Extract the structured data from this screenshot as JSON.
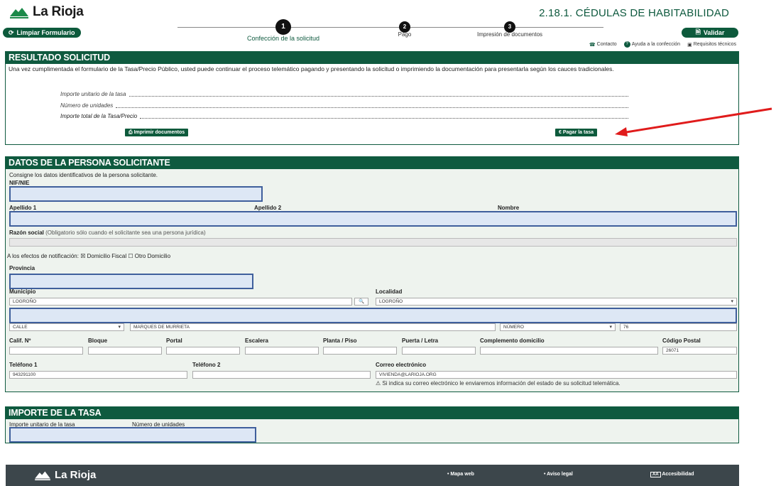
{
  "header": {
    "logo_text": "La Rioja",
    "procedure_title": "2.18.1. CÉDULAS DE HABITABILIDAD",
    "clear_button": "Limpiar Formulario",
    "validate_button": "Validar"
  },
  "steps": [
    {
      "number": "1",
      "label": "Confección de la solicitud"
    },
    {
      "number": "2",
      "label": "Pago"
    },
    {
      "number": "3",
      "label": "Impresión de documentos"
    }
  ],
  "help_links": {
    "contact": "Contacto",
    "help": "Ayuda a la confección",
    "requirements": "Requisitos técnicos"
  },
  "result": {
    "title": "RESULTADO SOLICITUD",
    "text": "Una vez cumplimentada el formulario de la Tasa/Precio Público, usted puede continuar el proceso telemático pagando y presentando la solicitud o imprimiendo la documentación para presentarla según los cauces tradicionales.",
    "unit_price_label": "Importe unitario de la tasa",
    "units_label": "Número de unidades",
    "total_label": "Importe total de la Tasa/Precio",
    "print_button": "Imprimir documentos",
    "pay_button": "€ Pagar la tasa"
  },
  "applicant": {
    "title": "DATOS DE LA PERSONA SOLICITANTE",
    "intro": "Consigne los datos identificativos de la persona solicitante.",
    "nif_label": "NIF/NIE",
    "surname1_label": "Apellido 1",
    "surname2_label": "Apellido 2",
    "name_label": "Nombre",
    "business_label": "Razón social",
    "business_note": "(Obligatorio sólo cuando el solicitante sea una persona jurídica)",
    "notification_label": "A los efectos de notificación:",
    "notif_option1": "Domicilio Fiscal",
    "notif_option2": "Otro Domicilio",
    "province_label": "Provincia",
    "municipality_label": "Municipio",
    "municipality_value": "LOGROÑO",
    "locality_label": "Localidad",
    "locality_value": "LOGROÑO",
    "street_type": "CALLE",
    "street_name": "MARQUES DE MURRIETA",
    "number_type": "NÚMERO",
    "number_value": "76",
    "calif_label": "Calif. Nº",
    "block_label": "Bloque",
    "portal_label": "Portal",
    "stair_label": "Escalera",
    "floor_label": "Planta / Piso",
    "door_label": "Puerta / Letra",
    "complement_label": "Complemento domicilio",
    "postal_label": "Código Postal",
    "postal_value": "26071",
    "phone1_label": "Teléfono 1",
    "phone1_value": "943291100",
    "phone2_label": "Teléfono 2",
    "email_label": "Correo electrónico",
    "email_value": "VIVIENDA@LARIOJA.ORG",
    "email_note": "Si indica su correo electrónico le enviaremos información del estado de su solicitud telemática."
  },
  "fee": {
    "title": "IMPORTE DE LA TASA",
    "unit_price_label": "Importe unitario de la tasa",
    "units_label": "Número de unidades"
  },
  "footer": {
    "logo_text": "La Rioja",
    "sitemap": "Mapa web",
    "legal": "Aviso legal",
    "accessibility": "Accesibilidad",
    "accessibility_icon_text": "AA"
  },
  "colors": {
    "primary": "#0f5a3f",
    "field_highlight": "#3f5f9c",
    "annotation_arrow": "#e01b1b",
    "footer": "#3c464b"
  }
}
